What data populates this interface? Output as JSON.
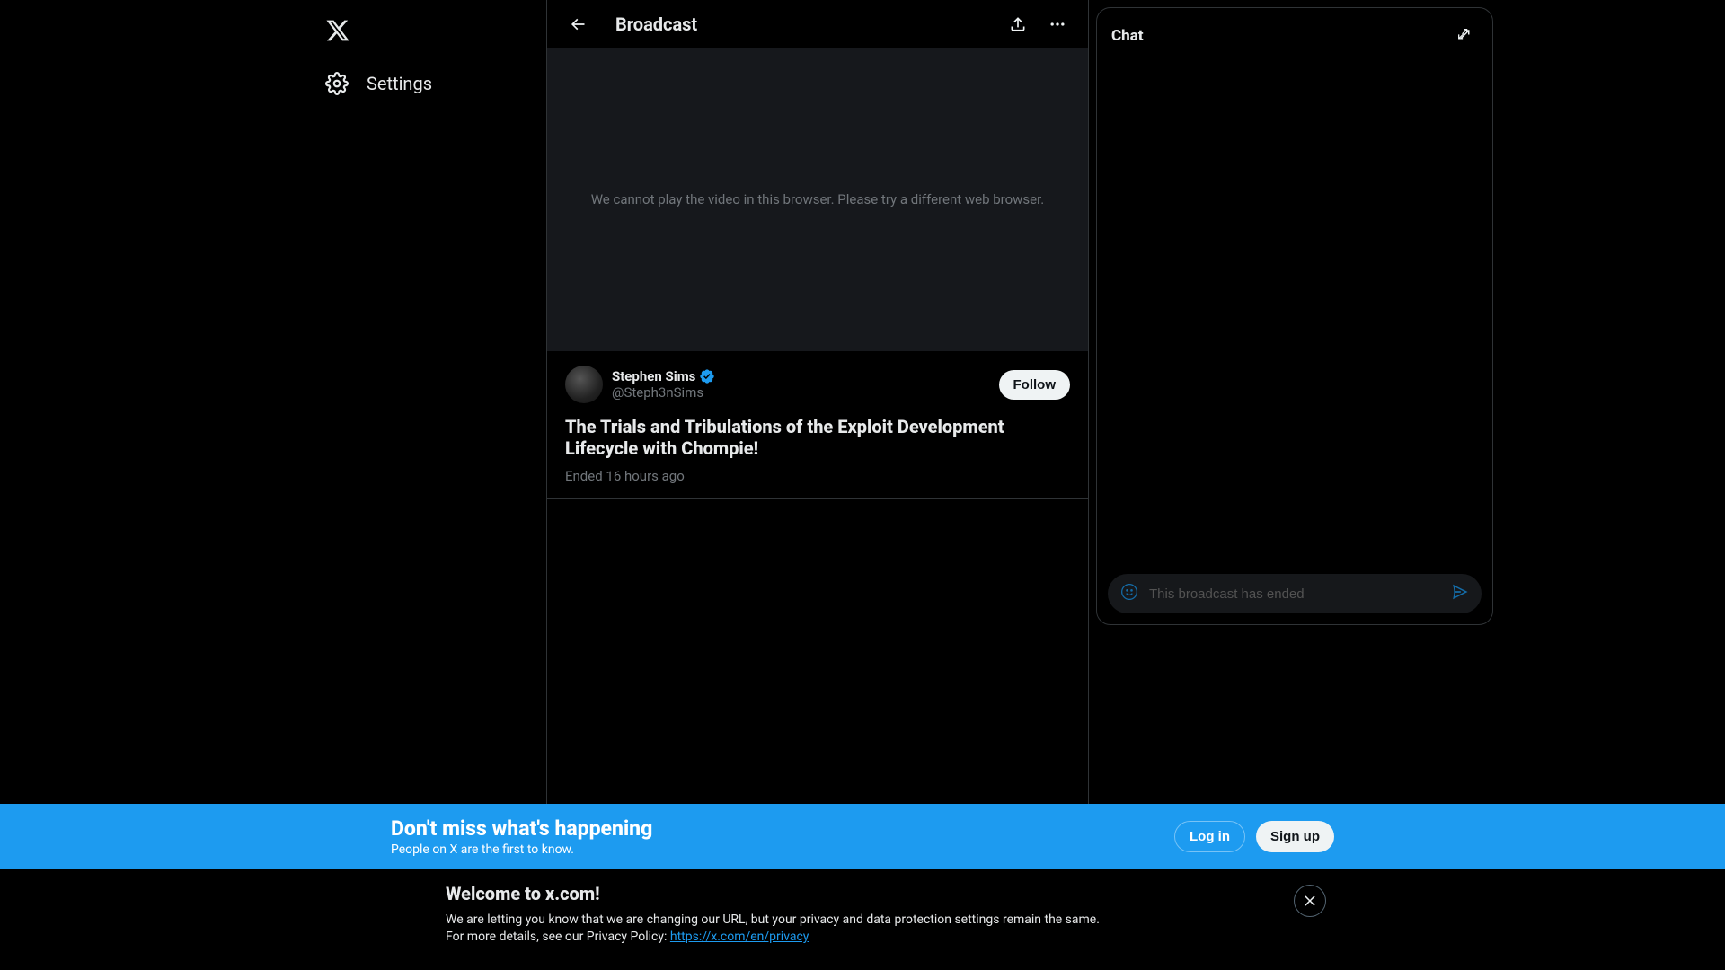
{
  "sidebar": {
    "settings_label": "Settings"
  },
  "header": {
    "title": "Broadcast"
  },
  "video": {
    "error_message": "We cannot play the video in this browser. Please try a different web browser."
  },
  "user": {
    "display_name": "Stephen Sims",
    "handle": "@Steph3nSims"
  },
  "follow_label": "Follow",
  "broadcast": {
    "title": "The Trials and Tribulations of the Exploit Development Lifecycle with Chompie!",
    "status": "Ended 16 hours ago"
  },
  "chat": {
    "title": "Chat",
    "placeholder": "This broadcast has ended"
  },
  "banner": {
    "heading": "Don't miss what's happening",
    "subtext": "People on X are the first to know.",
    "login_label": "Log in",
    "signup_label": "Sign up"
  },
  "notice": {
    "heading": "Welcome to x.com!",
    "body_prefix": "We are letting you know that we are changing our URL, but your privacy and data protection settings remain the same.",
    "body_line2_prefix": "For more details, see our Privacy Policy: ",
    "link_text": "https://x.com/en/privacy"
  }
}
